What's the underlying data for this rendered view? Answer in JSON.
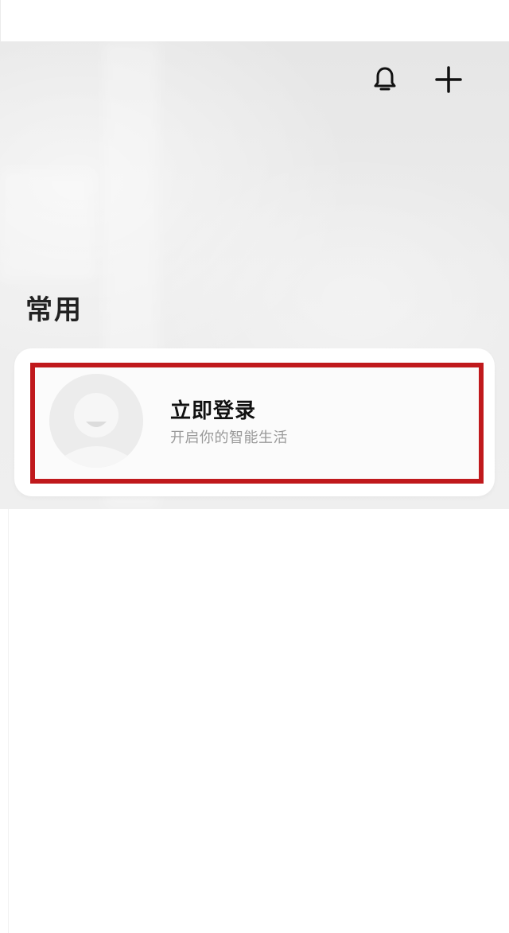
{
  "header": {
    "icons": {
      "notifications": "bell-icon",
      "add": "plus-icon"
    }
  },
  "section": {
    "title": "常用"
  },
  "login_card": {
    "title": "立即登录",
    "subtitle": "开启你的智能生活",
    "avatar_icon": "default-avatar-icon",
    "highlight_color": "#c0191c"
  }
}
